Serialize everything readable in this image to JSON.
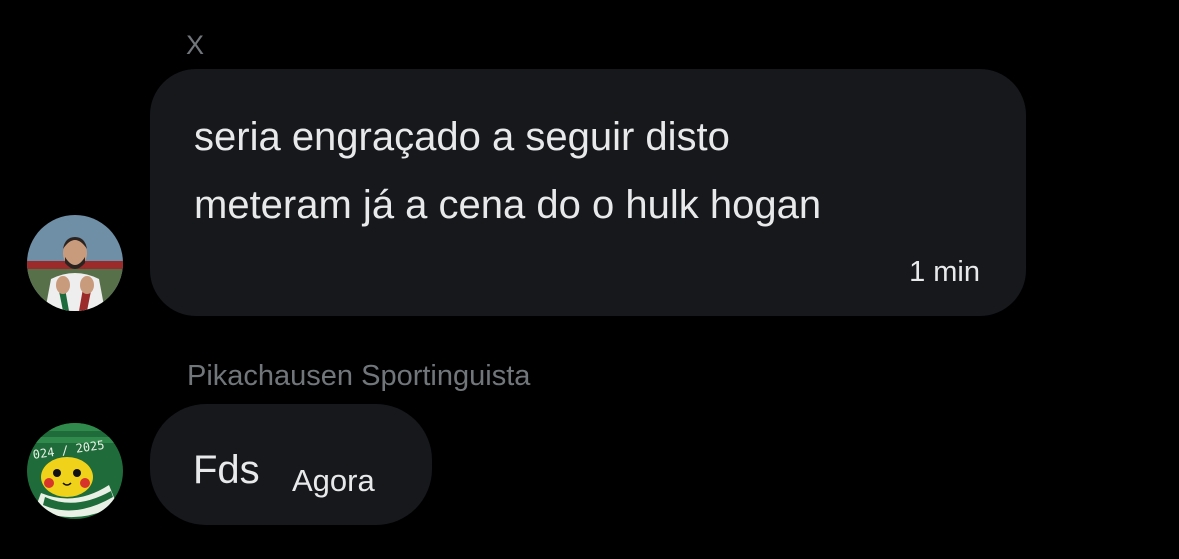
{
  "conversation": {
    "messages": [
      {
        "sender": "X",
        "lines": [
          "seria engraçado a seguir disto",
          "meteram já a cena do o hulk hogan"
        ],
        "time": "1 min",
        "avatar": "footballer-avatar"
      },
      {
        "sender": "Pikachausen Sportinguista",
        "lines": [
          "Fds"
        ],
        "time": "Agora",
        "avatar": "pikachu-sporting-avatar",
        "avatar_text": "024 / 2025"
      }
    ]
  },
  "colors": {
    "background": "#000000",
    "bubble": "#16181c",
    "text": "#e7e9ea",
    "secondary_text": "#71767b",
    "sporting_green": "#1f6b3a"
  }
}
